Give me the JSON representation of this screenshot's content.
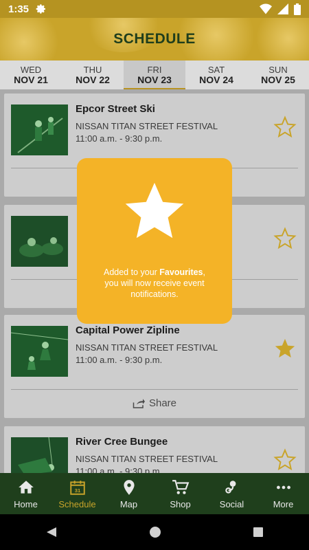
{
  "status_bar": {
    "time": "1:35"
  },
  "header": {
    "title": "SCHEDULE"
  },
  "days": [
    {
      "dow": "WED",
      "date": "NOV 21",
      "active": false
    },
    {
      "dow": "THU",
      "date": "NOV 22",
      "active": false
    },
    {
      "dow": "FRI",
      "date": "NOV 23",
      "active": true
    },
    {
      "dow": "SAT",
      "date": "NOV 24",
      "active": false
    },
    {
      "dow": "SUN",
      "date": "NOV 25",
      "active": false
    }
  ],
  "events": [
    {
      "name": "Epcor Street Ski",
      "venue": "NISSAN TITAN STREET FESTIVAL",
      "hours": "11:00 a.m. - 9:30 p.m.",
      "favorite": false
    },
    {
      "name": "",
      "venue": "",
      "hours": "",
      "favorite": false
    },
    {
      "name": "Capital Power Zipline",
      "venue": "NISSAN TITAN STREET FESTIVAL",
      "hours": "11:00 a.m. - 9:30 p.m.",
      "favorite": true,
      "share_label": "Share"
    },
    {
      "name": "River Cree Bungee",
      "venue": "NISSAN TITAN STREET FESTIVAL",
      "hours": "11:00 a.m. - 9:30 p.m.",
      "favorite": false
    }
  ],
  "toast": {
    "line1_prefix": "Added to your ",
    "line1_bold": "Favourites",
    "line1_suffix": ",",
    "line2": "you will now receive event",
    "line3": "notifications."
  },
  "bottom_nav": [
    {
      "label": "Home",
      "icon": "home-icon"
    },
    {
      "label": "Schedule",
      "icon": "calendar-icon",
      "badge": "31"
    },
    {
      "label": "Map",
      "icon": "map-pin-icon"
    },
    {
      "label": "Shop",
      "icon": "cart-icon"
    },
    {
      "label": "Social",
      "icon": "social-icon"
    },
    {
      "label": "More",
      "icon": "more-icon"
    }
  ],
  "colors": {
    "accent": "#c9a42a",
    "nav_bg": "#1f3f1c",
    "toast": "#f4b327",
    "star": "#c9a42a"
  }
}
